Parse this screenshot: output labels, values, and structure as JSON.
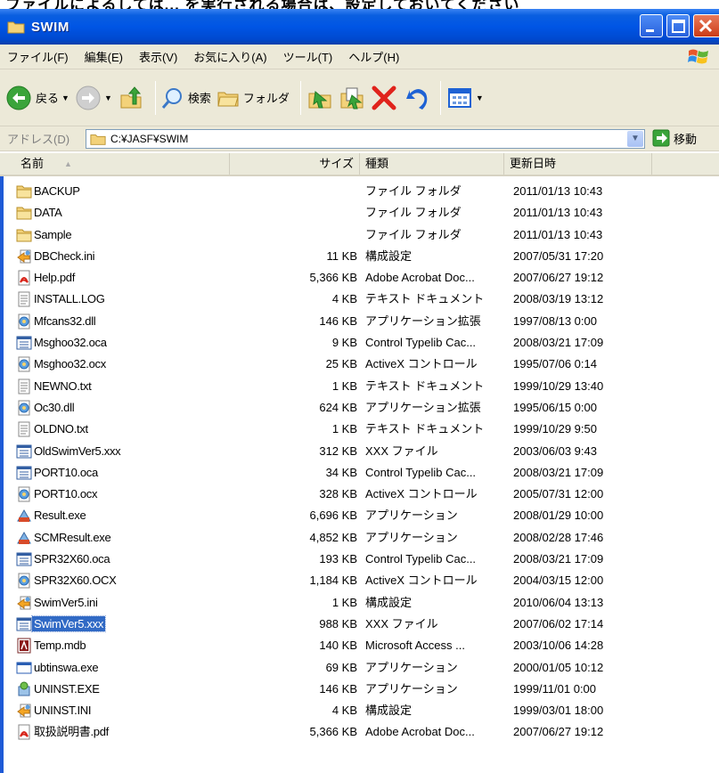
{
  "caption": "ファイルによるしては... を実行される場合は、設定しておいてください",
  "window": {
    "title": "SWIM"
  },
  "menu": [
    {
      "label": "ファイル(F)"
    },
    {
      "label": "編集(E)"
    },
    {
      "label": "表示(V)"
    },
    {
      "label": "お気に入り(A)"
    },
    {
      "label": "ツール(T)"
    },
    {
      "label": "ヘルプ(H)"
    }
  ],
  "toolbar": {
    "back_label": "戻る",
    "search_label": "検索",
    "folders_label": "フォルダ"
  },
  "address": {
    "label": "アドレス(D)",
    "path": "C:¥JASF¥SWIM",
    "go_label": "移動"
  },
  "columns": {
    "name": "名前",
    "size": "サイズ",
    "type": "種類",
    "modified": "更新日時"
  },
  "files": [
    {
      "name": "BACKUP",
      "size": "",
      "type": "ファイル フォルダ",
      "modified": "2011/01/13 10:43",
      "icon": "folder-icon"
    },
    {
      "name": "DATA",
      "size": "",
      "type": "ファイル フォルダ",
      "modified": "2011/01/13 10:43",
      "icon": "folder-icon"
    },
    {
      "name": "Sample",
      "size": "",
      "type": "ファイル フォルダ",
      "modified": "2011/01/13 10:43",
      "icon": "folder-icon"
    },
    {
      "name": "DBCheck.ini",
      "size": "11 KB",
      "type": "構成設定",
      "modified": "2007/05/31 17:20",
      "icon": "settings-file-icon"
    },
    {
      "name": "Help.pdf",
      "size": "5,366 KB",
      "type": "Adobe Acrobat Doc...",
      "modified": "2007/06/27 19:12",
      "icon": "pdf-icon"
    },
    {
      "name": "INSTALL.LOG",
      "size": "4 KB",
      "type": "テキスト ドキュメント",
      "modified": "2008/03/19 13:12",
      "icon": "text-file-icon"
    },
    {
      "name": "Mfcans32.dll",
      "size": "146 KB",
      "type": "アプリケーション拡張",
      "modified": "1997/08/13 0:00",
      "icon": "dll-icon"
    },
    {
      "name": "Msghoo32.oca",
      "size": "9 KB",
      "type": "Control Typelib Cac...",
      "modified": "2008/03/21 17:09",
      "icon": "oca-file-icon"
    },
    {
      "name": "Msghoo32.ocx",
      "size": "25 KB",
      "type": "ActiveX コントロール",
      "modified": "1995/07/06 0:14",
      "icon": "dll-icon"
    },
    {
      "name": "NEWNO.txt",
      "size": "1 KB",
      "type": "テキスト ドキュメント",
      "modified": "1999/10/29 13:40",
      "icon": "text-file-icon"
    },
    {
      "name": "Oc30.dll",
      "size": "624 KB",
      "type": "アプリケーション拡張",
      "modified": "1995/06/15 0:00",
      "icon": "dll-icon"
    },
    {
      "name": "OLDNO.txt",
      "size": "1 KB",
      "type": "テキスト ドキュメント",
      "modified": "1999/10/29 9:50",
      "icon": "text-file-icon"
    },
    {
      "name": "OldSwimVer5.xxx",
      "size": "312 KB",
      "type": "XXX ファイル",
      "modified": "2003/06/03 9:43",
      "icon": "oca-file-icon"
    },
    {
      "name": "PORT10.oca",
      "size": "34 KB",
      "type": "Control Typelib Cac...",
      "modified": "2008/03/21 17:09",
      "icon": "oca-file-icon"
    },
    {
      "name": "PORT10.ocx",
      "size": "328 KB",
      "type": "ActiveX コントロール",
      "modified": "2005/07/31 12:00",
      "icon": "dll-icon"
    },
    {
      "name": "Result.exe",
      "size": "6,696 KB",
      "type": "アプリケーション",
      "modified": "2008/01/29 10:00",
      "icon": "exe-icon"
    },
    {
      "name": "SCMResult.exe",
      "size": "4,852 KB",
      "type": "アプリケーション",
      "modified": "2008/02/28 17:46",
      "icon": "exe-icon"
    },
    {
      "name": "SPR32X60.oca",
      "size": "193 KB",
      "type": "Control Typelib Cac...",
      "modified": "2008/03/21 17:09",
      "icon": "oca-file-icon"
    },
    {
      "name": "SPR32X60.OCX",
      "size": "1,184 KB",
      "type": "ActiveX コントロール",
      "modified": "2004/03/15 12:00",
      "icon": "dll-icon"
    },
    {
      "name": "SwimVer5.ini",
      "size": "1 KB",
      "type": "構成設定",
      "modified": "2010/06/04 13:13",
      "icon": "settings-file-icon"
    },
    {
      "name": "SwimVer5.xxx",
      "size": "988 KB",
      "type": "XXX ファイル",
      "modified": "2007/06/02 17:14",
      "icon": "oca-file-icon",
      "selected": true
    },
    {
      "name": "Temp.mdb",
      "size": "140 KB",
      "type": "Microsoft Access ...",
      "modified": "2003/10/06 14:28",
      "icon": "access-icon"
    },
    {
      "name": "ubtinswa.exe",
      "size": "69 KB",
      "type": "アプリケーション",
      "modified": "2000/01/05 10:12",
      "icon": "window-app-icon"
    },
    {
      "name": "UNINST.EXE",
      "size": "146 KB",
      "type": "アプリケーション",
      "modified": "1999/11/01 0:00",
      "icon": "installer-icon"
    },
    {
      "name": "UNINST.INI",
      "size": "4 KB",
      "type": "構成設定",
      "modified": "1999/03/01 18:00",
      "icon": "settings-file-icon"
    },
    {
      "name": "取扱説明書.pdf",
      "size": "5,366 KB",
      "type": "Adobe Acrobat Doc...",
      "modified": "2007/06/27 19:12",
      "icon": "pdf-icon"
    }
  ]
}
